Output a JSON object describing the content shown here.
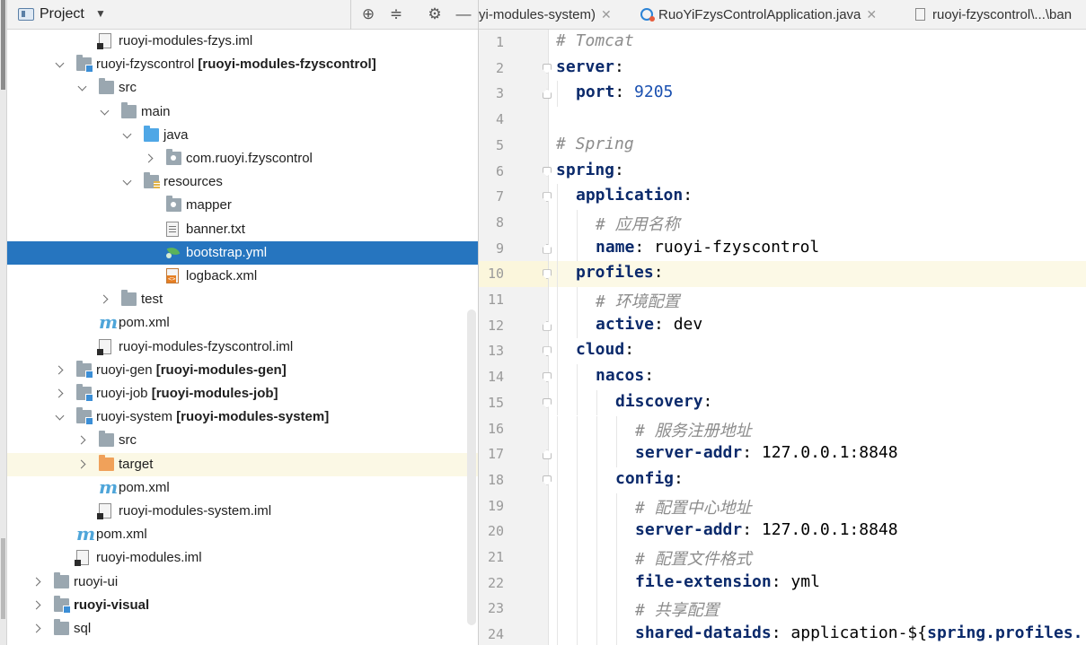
{
  "project_panel": {
    "title": "Project",
    "header_icons": [
      "locate-icon",
      "collapse-all-icon",
      "gear-icon",
      "minimize-icon"
    ],
    "tree": [
      {
        "label": "ruoyi-modules-fzys.iml",
        "suffix": "",
        "icon": "iml-file-icon",
        "expand": "none",
        "level": 3,
        "bold": false
      },
      {
        "label": "ruoyi-fzyscontrol",
        "suffix": "[ruoyi-modules-fzyscontrol]",
        "icon": "module-folder-icon",
        "expand": "down",
        "level": 2,
        "bold": false
      },
      {
        "label": "src",
        "suffix": "",
        "icon": "folder-icon",
        "expand": "down",
        "level": 3,
        "bold": false
      },
      {
        "label": "main",
        "suffix": "",
        "icon": "folder-icon",
        "expand": "down",
        "level": 4,
        "bold": false
      },
      {
        "label": "java",
        "suffix": "",
        "icon": "source-folder-icon",
        "expand": "down",
        "level": 5,
        "bold": false
      },
      {
        "label": "com.ruoyi.fzyscontrol",
        "suffix": "",
        "icon": "package-icon",
        "expand": "right",
        "level": 6,
        "bold": false
      },
      {
        "label": "resources",
        "suffix": "",
        "icon": "resources-folder-icon",
        "expand": "down",
        "level": 5,
        "bold": false
      },
      {
        "label": "mapper",
        "suffix": "",
        "icon": "package-icon",
        "expand": "none",
        "level": 6,
        "bold": false
      },
      {
        "label": "banner.txt",
        "suffix": "",
        "icon": "text-file-icon",
        "expand": "none",
        "level": 6,
        "bold": false
      },
      {
        "label": "bootstrap.yml",
        "suffix": "",
        "icon": "yaml-file-icon",
        "expand": "none",
        "level": 6,
        "bold": false,
        "selected": true
      },
      {
        "label": "logback.xml",
        "suffix": "",
        "icon": "xml-file-icon",
        "expand": "none",
        "level": 6,
        "bold": false
      },
      {
        "label": "test",
        "suffix": "",
        "icon": "folder-icon",
        "expand": "right",
        "level": 4,
        "bold": false
      },
      {
        "label": "pom.xml",
        "suffix": "",
        "icon": "maven-icon",
        "expand": "none",
        "level": 3,
        "bold": false
      },
      {
        "label": "ruoyi-modules-fzyscontrol.iml",
        "suffix": "",
        "icon": "iml-file-icon",
        "expand": "none",
        "level": 3,
        "bold": false
      },
      {
        "label": "ruoyi-gen",
        "suffix": "[ruoyi-modules-gen]",
        "icon": "module-folder-icon",
        "expand": "right",
        "level": 2,
        "bold": false
      },
      {
        "label": "ruoyi-job",
        "suffix": "[ruoyi-modules-job]",
        "icon": "module-folder-icon",
        "expand": "right",
        "level": 2,
        "bold": false
      },
      {
        "label": "ruoyi-system",
        "suffix": "[ruoyi-modules-system]",
        "icon": "module-folder-icon",
        "expand": "down",
        "level": 2,
        "bold": false
      },
      {
        "label": "src",
        "suffix": "",
        "icon": "folder-icon",
        "expand": "right",
        "level": 3,
        "bold": false
      },
      {
        "label": "target",
        "suffix": "",
        "icon": "excluded-folder-icon",
        "expand": "right",
        "level": 3,
        "bold": false,
        "highlight": true
      },
      {
        "label": "pom.xml",
        "suffix": "",
        "icon": "maven-icon",
        "expand": "none",
        "level": 3,
        "bold": false
      },
      {
        "label": "ruoyi-modules-system.iml",
        "suffix": "",
        "icon": "iml-file-icon",
        "expand": "none",
        "level": 3,
        "bold": false
      },
      {
        "label": "pom.xml",
        "suffix": "",
        "icon": "maven-icon",
        "expand": "none",
        "level": 2,
        "bold": false
      },
      {
        "label": "ruoyi-modules.iml",
        "suffix": "",
        "icon": "iml-file-icon",
        "expand": "none",
        "level": 2,
        "bold": false
      },
      {
        "label": "ruoyi-ui",
        "suffix": "",
        "icon": "folder-icon",
        "expand": "right",
        "level": 1,
        "bold": false
      },
      {
        "label": "ruoyi-visual",
        "suffix": "",
        "icon": "module-folder-icon",
        "expand": "right",
        "level": 1,
        "bold": true
      },
      {
        "label": "sql",
        "suffix": "",
        "icon": "folder-icon",
        "expand": "right",
        "level": 1,
        "bold": false
      }
    ]
  },
  "editor": {
    "tabs": [
      {
        "label": "yi-modules-system)",
        "icon": "none"
      },
      {
        "label": "RuoYiFzysControlApplication.java",
        "icon": "java-class-icon"
      },
      {
        "label": "ruoyi-fzyscontrol\\...\\ban",
        "icon": "text-file-icon"
      }
    ],
    "current_line": 10,
    "lines": [
      {
        "n": "1",
        "fold": "",
        "indent": 0,
        "tokens": [
          [
            "c",
            "# Tomcat"
          ]
        ]
      },
      {
        "n": "2",
        "fold": "open",
        "indent": 0,
        "tokens": [
          [
            "k",
            "server"
          ],
          [
            "p",
            ":"
          ]
        ]
      },
      {
        "n": "3",
        "fold": "close",
        "indent": 1,
        "tokens": [
          [
            "k",
            "port"
          ],
          [
            "p",
            ": "
          ],
          [
            "num",
            "9205"
          ]
        ]
      },
      {
        "n": "4",
        "fold": "",
        "indent": 0,
        "tokens": []
      },
      {
        "n": "5",
        "fold": "",
        "indent": 0,
        "tokens": [
          [
            "c",
            "# Spring"
          ]
        ]
      },
      {
        "n": "6",
        "fold": "open",
        "indent": 0,
        "tokens": [
          [
            "k",
            "spring"
          ],
          [
            "p",
            ":"
          ]
        ]
      },
      {
        "n": "7",
        "fold": "open",
        "indent": 1,
        "tokens": [
          [
            "k",
            "application"
          ],
          [
            "p",
            ":"
          ]
        ]
      },
      {
        "n": "8",
        "fold": "",
        "indent": 2,
        "tokens": [
          [
            "c",
            "# 应用名称"
          ]
        ]
      },
      {
        "n": "9",
        "fold": "close",
        "indent": 2,
        "tokens": [
          [
            "k",
            "name"
          ],
          [
            "p",
            ": ruoyi-fzyscontrol"
          ]
        ]
      },
      {
        "n": "10",
        "fold": "open",
        "indent": 1,
        "tokens": [
          [
            "k",
            "profiles"
          ],
          [
            "p",
            ":"
          ]
        ]
      },
      {
        "n": "11",
        "fold": "",
        "indent": 2,
        "tokens": [
          [
            "c",
            "# 环境配置"
          ]
        ]
      },
      {
        "n": "12",
        "fold": "close",
        "indent": 2,
        "tokens": [
          [
            "k",
            "active"
          ],
          [
            "p",
            ": dev"
          ]
        ]
      },
      {
        "n": "13",
        "fold": "open",
        "indent": 1,
        "tokens": [
          [
            "k",
            "cloud"
          ],
          [
            "p",
            ":"
          ]
        ]
      },
      {
        "n": "14",
        "fold": "open",
        "indent": 2,
        "tokens": [
          [
            "k",
            "nacos"
          ],
          [
            "p",
            ":"
          ]
        ]
      },
      {
        "n": "15",
        "fold": "open",
        "indent": 3,
        "tokens": [
          [
            "k",
            "discovery"
          ],
          [
            "p",
            ":"
          ]
        ]
      },
      {
        "n": "16",
        "fold": "",
        "indent": 4,
        "tokens": [
          [
            "c",
            "# 服务注册地址"
          ]
        ]
      },
      {
        "n": "17",
        "fold": "close",
        "indent": 4,
        "tokens": [
          [
            "k",
            "server-addr"
          ],
          [
            "p",
            ": 127.0.0.1:8848"
          ]
        ]
      },
      {
        "n": "18",
        "fold": "open",
        "indent": 3,
        "tokens": [
          [
            "k",
            "config"
          ],
          [
            "p",
            ":"
          ]
        ]
      },
      {
        "n": "19",
        "fold": "",
        "indent": 4,
        "tokens": [
          [
            "c",
            "# 配置中心地址"
          ]
        ]
      },
      {
        "n": "20",
        "fold": "",
        "indent": 4,
        "tokens": [
          [
            "k",
            "server-addr"
          ],
          [
            "p",
            ": 127.0.0.1:8848"
          ]
        ]
      },
      {
        "n": "21",
        "fold": "",
        "indent": 4,
        "tokens": [
          [
            "c",
            "# 配置文件格式"
          ]
        ]
      },
      {
        "n": "22",
        "fold": "",
        "indent": 4,
        "tokens": [
          [
            "k",
            "file-extension"
          ],
          [
            "p",
            ": yml"
          ]
        ]
      },
      {
        "n": "23",
        "fold": "",
        "indent": 4,
        "tokens": [
          [
            "c",
            "# 共享配置"
          ]
        ]
      },
      {
        "n": "24",
        "fold": "",
        "indent": 4,
        "tokens": [
          [
            "k",
            "shared-dataids"
          ],
          [
            "p",
            ": application-${"
          ],
          [
            "i",
            "spring.profiles."
          ]
        ]
      }
    ]
  },
  "colors": {
    "selection": "#2675bf",
    "current_line": "#fcf9e6",
    "yaml_key": "#0b2a6b",
    "yaml_number": "#1a50b0",
    "comment": "#8c8c8c"
  }
}
